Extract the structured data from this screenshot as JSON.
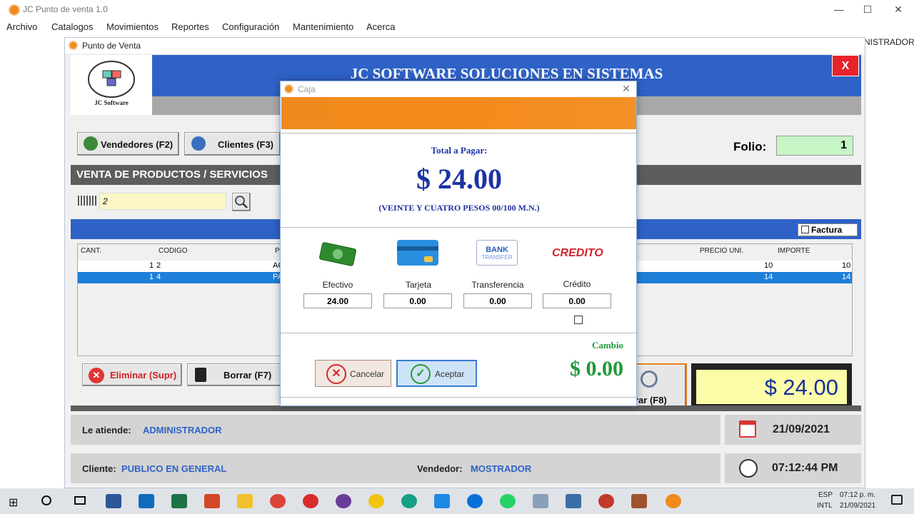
{
  "app": {
    "title": "JC Punto de venta 1.0",
    "bg_label": "NISTRADOR"
  },
  "menu": [
    "Archivo",
    "Catalogos",
    "Movimientos",
    "Reportes",
    "Configuración",
    "Mantenimiento",
    "Acerca"
  ],
  "form": {
    "title": "Punto de Venta",
    "logo_text": "JC Software",
    "banner": "JC SOFTWARE SOLUCIONES EN SISTEMAS",
    "close": "X"
  },
  "buttons": {
    "vendedores": "Vendedores (F2)",
    "clientes": "Clientes (F3)",
    "eliminar": "Eliminar (Supr)",
    "borrar": "Borrar (F7)",
    "cobrar": "rar (F8)"
  },
  "folio": {
    "label": "Folio:",
    "value": "1"
  },
  "section": {
    "title": "VENTA DE PRODUCTOS / SERVICIOS"
  },
  "search": {
    "value": "2"
  },
  "factura": {
    "label": "Factura"
  },
  "grid": {
    "headers": [
      "CANT.",
      "CODIGO",
      "PR",
      "PRECIO UNI.",
      "IMPORTE"
    ],
    "rows": [
      {
        "cant": "1",
        "codigo": "2",
        "desc": "AG",
        "precio": "10",
        "importe": "10"
      },
      {
        "cant": "1",
        "codigo": "4",
        "desc": "PA",
        "precio": "14",
        "importe": "14"
      }
    ]
  },
  "total": "$ 24.00",
  "footer": {
    "atiende_label": "Le atiende:",
    "atiende": "ADMINISTRADOR",
    "cliente_label": "Cliente:",
    "cliente": "PUBLICO EN GENERAL",
    "vendedor_label": "Vendedor:",
    "vendedor": "MOSTRADOR",
    "date": "21/09/2021",
    "time": "07:12:44 PM"
  },
  "caja": {
    "title": "Caja",
    "total_label": "Total a Pagar:",
    "total": "$ 24.00",
    "words": "(VEINTE Y CUATRO PESOS 00/100 M.N.)",
    "methods": [
      {
        "label": "Efectivo",
        "value": "24.00",
        "icon": "cash-icon"
      },
      {
        "label": "Tarjeta",
        "value": "0.00",
        "icon": "card-icon"
      },
      {
        "label": "Transferencia",
        "value": "0.00",
        "icon": "bank-transfer-icon"
      },
      {
        "label": "Crédito",
        "value": "0.00",
        "icon": "credit-icon"
      }
    ],
    "bank_line1": "BANK",
    "bank_line2": "TRANSFER",
    "credito_logo": "CREDITO",
    "cambio_label": "Cambio",
    "cambio": "$ 0.00",
    "cancel": "Cancelar",
    "accept": "Aceptar"
  },
  "taskbar": {
    "lang1": "ESP",
    "lang2": "INTL",
    "time": "07:12 p. m.",
    "date": "21/09/2021"
  },
  "colors": {
    "blue": "#2f62c7",
    "orange": "#f08a1c",
    "green": "#1e9a3a",
    "navy": "#1c34a4"
  }
}
